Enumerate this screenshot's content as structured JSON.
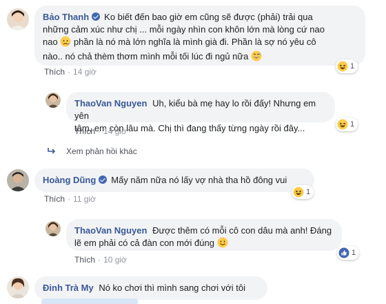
{
  "comments": [
    {
      "author": "Bảo Thanh",
      "verified": true,
      "text_1": "Ko biết đến bao giờ em cũng sẽ được (phải) trải qua",
      "text_2": "những cảm xúc như chị ... mỗi ngày nhìn con khôn lớn mà lòng cứ nao",
      "text_3a": "nao",
      "text_3b": "phần là nó mà lớn nghĩa là mình già đi. Phần là sợ nó yêu cô",
      "text_4": "nào.. nó chả thèm thơm mình mỗi tối lúc đi ngủ nữa",
      "like_label": "Thích",
      "time": "14 giờ",
      "reaction_count": "1",
      "reaction_icon": "haha-icon"
    },
    {
      "author": "ThaoVan Nguyen",
      "verified": false,
      "text_1": "Uh, kiểu bà mẹ hay lo rồi đấy! Nhưng em yên",
      "text_2": "tâm, em còn lâu mà. Chị thì đang thấy từng ngày rồi đây...",
      "like_label": "Thích",
      "time": "14 giờ",
      "reaction_count": "1",
      "reaction_icon": "haha-icon"
    },
    {
      "author": "Hoàng Dũng",
      "verified": true,
      "text_1": "Mấy năm nữa nó lấy vợ nhà tha hồ đông vui",
      "like_label": "Thích",
      "time": "11 giờ",
      "reaction_count": "1",
      "reaction_icon": "haha-icon"
    },
    {
      "author": "ThaoVan Nguyen",
      "verified": false,
      "text_1": "Được thêm có mỗi cô con dâu mà anh! Đáng",
      "text_2": "lẽ em phải có cả đàn con mới đúng",
      "like_label": "Thích",
      "time": "10 giờ",
      "reaction_count": "1",
      "reaction_icon": "like-icon"
    },
    {
      "author": "Đinh Trà My",
      "verified": false,
      "text_1": "Nó ko chơi thì mình sang chơi với tôi"
    }
  ],
  "more_replies_label": "Xem phản hồi khác",
  "colors": {
    "author": "#385898",
    "bubble": "#f2f3f5",
    "meta": "#90949c",
    "verified": "#4267b2"
  }
}
